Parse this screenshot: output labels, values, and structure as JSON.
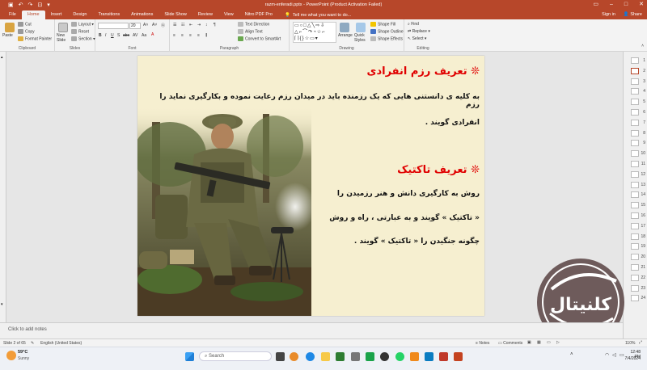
{
  "window": {
    "title": "razm-enferadi.pptx  -  PowerPoint (Product Activation Failed)",
    "accent": "#b7472a"
  },
  "tabs": [
    "File",
    "Home",
    "Insert",
    "Design",
    "Transitions",
    "Animations",
    "Slide Show",
    "Review",
    "View",
    "Nitro PDF Pro"
  ],
  "tell_me": "Tell me what you want to do...",
  "account": {
    "sign_in": "Sign in",
    "share": "Share"
  },
  "ribbon": {
    "clipboard": {
      "label": "Clipboard",
      "paste": "Paste",
      "cut": "Cut",
      "copy": "Copy",
      "format_painter": "Format Painter"
    },
    "slides": {
      "label": "Slides",
      "new_slide": "New Slide",
      "layout": "Layout",
      "reset": "Reset",
      "section": "Section"
    },
    "font": {
      "label": "Font",
      "size": "20"
    },
    "paragraph": {
      "label": "Paragraph",
      "text_direction": "Text Direction",
      "align_text": "Align Text",
      "smartart": "Convert to SmartArt"
    },
    "drawing": {
      "label": "Drawing",
      "arrange": "Arrange",
      "quick_styles": "Quick Styles",
      "shape_fill": "Shape Fill",
      "shape_outline": "Shape Outline",
      "shape_effects": "Shape Effects"
    },
    "editing": {
      "label": "Editing",
      "find": "Find",
      "replace": "Replace",
      "select": "Select"
    }
  },
  "slide": {
    "heading1": "❊ تعریف رزم انفرادی",
    "para1_line1": "به کلیه ی دانستنی هایی که یک رزمنده باید در میدان رزم رعایت نموده  و بکارگیری نماید را رزم",
    "para1_line2": "انفرادی گویند .",
    "heading2": "❊ تعریف تاکتیک",
    "para2_line1": "روش به کارگیری دانش و هنر رزمیدن را",
    "para2_line2": "« تاکتیک » گویند و به عبارتی ، راه و روش",
    "para2_line3": "چگونه جنگیدن را « تاکتیک » گویند ."
  },
  "thumbnails": [
    "1",
    "2",
    "3",
    "4",
    "5",
    "6",
    "7",
    "8",
    "9",
    "10",
    "11",
    "12",
    "13",
    "14",
    "15",
    "16",
    "17",
    "18",
    "19",
    "20",
    "21",
    "22",
    "23",
    "24"
  ],
  "selected_thumbnail": "2",
  "notes_placeholder": "Click to add notes",
  "status": {
    "slide": "Slide 2 of 65",
    "language": "English (United States)",
    "notes": "Notes",
    "comments": "Comments",
    "zoom": "110%"
  },
  "taskbar": {
    "weather_temp": "59°C",
    "weather_desc": "Sunny",
    "search": "Search",
    "time": "12:48 PM",
    "date": "7/4/2024"
  },
  "watermark_text": "کلنیتال"
}
